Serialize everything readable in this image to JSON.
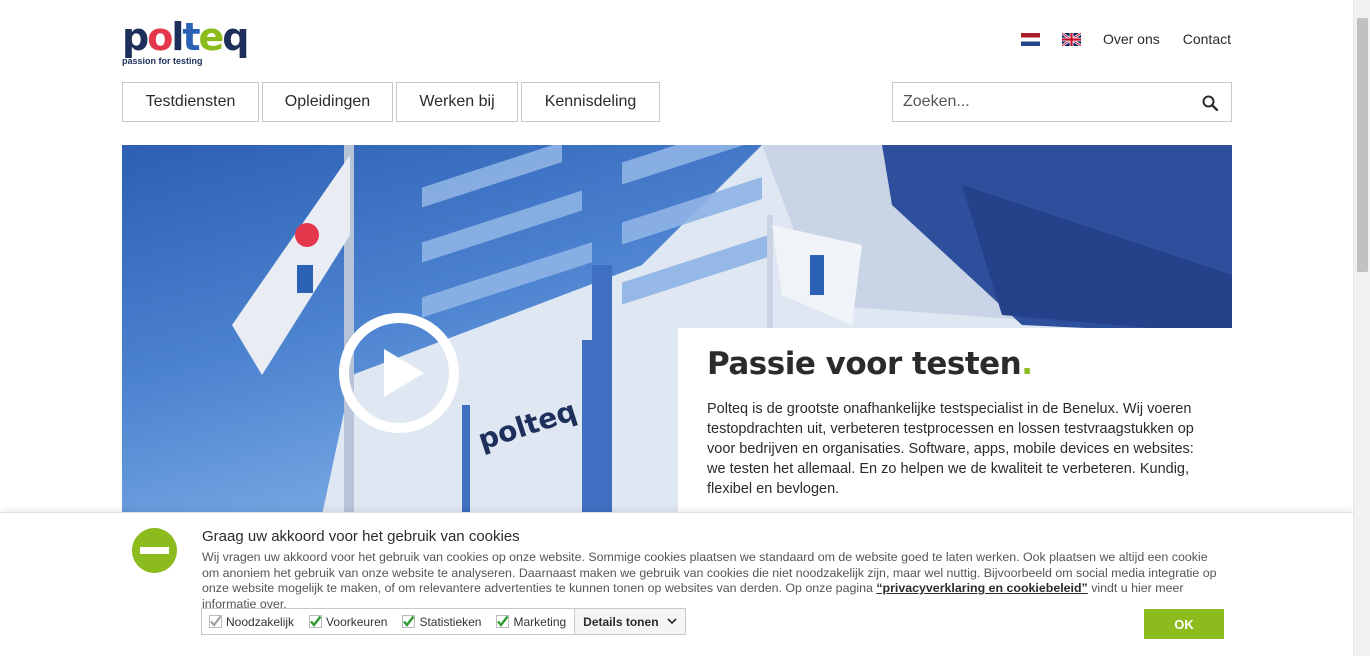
{
  "header": {
    "logo_text": "polteq",
    "logo_tagline": "passion for testing",
    "languages": [
      {
        "name": "nl-flag-icon",
        "code": "NL"
      },
      {
        "name": "uk-flag-icon",
        "code": "EN"
      }
    ],
    "links": [
      "Over ons",
      "Contact"
    ]
  },
  "nav": {
    "items": [
      "Testdiensten",
      "Opleidingen",
      "Werken bij",
      "Kennisdeling"
    ]
  },
  "search": {
    "placeholder": "Zoeken...",
    "icon": "search-icon"
  },
  "hero": {
    "title": "Passie voor testen",
    "title_dot": ".",
    "text": "Polteq is de grootste onafhankelijke testspecialist in de Benelux. Wij voeren testopdrachten uit, verbeteren testprocessen en lossen testvraagstukken op voor bedrijven en organisaties. Software, apps, mobile devices en websites: we testen het allemaal. En zo helpen we de kwaliteit te verbeteren. Kundig, flexibel en bevlogen.",
    "play_icon": "play-icon",
    "building_sign": "polteq"
  },
  "cookie": {
    "title": "Graag uw akkoord voor het gebruik van cookies",
    "text_before_link": "Wij vragen uw akkoord voor het gebruik van cookies op onze website. Sommige cookies plaatsen we standaard om de website goed te laten werken. Ook plaatsen we altijd een cookie om anoniem het gebruik van onze website te analyseren. Daarnaast maken we gebruik van cookies die niet noodzakelijk zijn, maar wel nuttig. Bijvoorbeeld om social media integratie op onze website mogelijk te maken, of om relevantere advertenties te kunnen tonen op websites van derden. Op onze pagina ",
    "link_text": "“privacyverklaring en cookiebeleid”",
    "text_after_link": " vindt u hier meer informatie over.",
    "options": [
      {
        "label": "Noodzakelijk",
        "checked": true,
        "disabled": true
      },
      {
        "label": "Voorkeuren",
        "checked": true,
        "disabled": false
      },
      {
        "label": "Statistieken",
        "checked": true,
        "disabled": false
      },
      {
        "label": "Marketing",
        "checked": true,
        "disabled": false
      }
    ],
    "details_label": "Details tonen",
    "ok_label": "OK"
  },
  "colors": {
    "accent_green": "#8bbb1d",
    "brand_navy": "#1e2f5c",
    "brand_red": "#e4374b",
    "brand_blue": "#2b62b6"
  }
}
